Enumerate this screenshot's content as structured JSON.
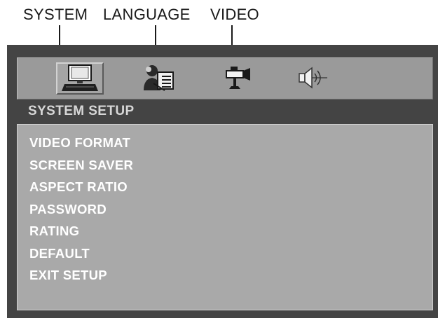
{
  "callouts": [
    {
      "label": "SYSTEM",
      "icon": "monitor-icon"
    },
    {
      "label": "LANGUAGE",
      "icon": "person-speaking-icon"
    },
    {
      "label": "VIDEO",
      "icon": "video-camera-icon"
    }
  ],
  "tabs": [
    {
      "icon": "monitor-icon",
      "active": true
    },
    {
      "icon": "person-speaking-icon",
      "active": false
    },
    {
      "icon": "video-camera-icon",
      "active": false
    },
    {
      "icon": "speaker-icon",
      "active": false
    }
  ],
  "section_title": "SYSTEM SETUP",
  "menu_items": [
    "VIDEO FORMAT",
    "SCREEN SAVER",
    "ASPECT RATIO",
    "PASSWORD",
    "RATING",
    "DEFAULT",
    "EXIT SETUP"
  ],
  "colors": {
    "osd_frame": "#444444",
    "icon_bar": "#9a9a9a",
    "menu_panel": "#a9a9a9",
    "menu_text": "#ffffff",
    "title_text": "#d7d7d7"
  }
}
